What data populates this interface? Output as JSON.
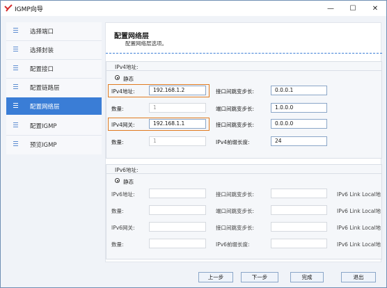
{
  "window": {
    "title": "IGMP向导",
    "minimize": "—",
    "maximize": "☐",
    "close": "✕"
  },
  "sidebar": {
    "items": [
      {
        "label": "选择端口",
        "active": false
      },
      {
        "label": "选择封装",
        "active": false
      },
      {
        "label": "配置接口",
        "active": false
      },
      {
        "label": "配置链路层",
        "active": false
      },
      {
        "label": "配置网络层",
        "active": true
      },
      {
        "label": "配置IGMP",
        "active": false
      },
      {
        "label": "预览IGMP",
        "active": false
      }
    ]
  },
  "main": {
    "title": "配置网络层",
    "subtitle": "配置网络层选项。",
    "ipv4": {
      "group_label": "IPv4地址:",
      "mode": "静态",
      "addr_label": "IPv4地址:",
      "addr_value": "192.168.1.2",
      "addr_count_label": "数量:",
      "addr_count_value": "1",
      "gw_label": "IPv4网关:",
      "gw_value": "192.168.1.1",
      "gw_count_label": "数量:",
      "gw_count_value": "1",
      "if_step_label": "接口间跳变步长:",
      "if_step_value": "0.0.0.1",
      "port_step_label": "端口间跳变步长:",
      "port_step_value": "1.0.0.0",
      "if_step2_label": "接口间跳变步长:",
      "if_step2_value": "0.0.0.0",
      "prefix_label": "IPv4前缀长度:",
      "prefix_value": "24"
    },
    "ipv6": {
      "group_label": "IPv6地址:",
      "mode": "静态",
      "addr_label": "IPv6地址:",
      "count1_label": "数量:",
      "gw_label": "IPv6网关:",
      "count2_label": "数量:",
      "if_step_label": "接口间跳变步长:",
      "port_step_label": "端口间跳变步长:",
      "if_step2_label": "接口间跳变步长:",
      "prefix_label": "IPv6前缀长度:",
      "link_local_1": "IPv6 Link Local地",
      "link_local_2": "IPv6 Link Local地",
      "link_local_3": "IPv6 Link Local地",
      "link_local_4": "IPv6 Link Local地"
    }
  },
  "footer": {
    "prev": "上一步",
    "next": "下一步",
    "finish": "完成",
    "exit": "退出"
  },
  "colors": {
    "accent": "#3a7dd6",
    "highlight": "#e07a1f"
  }
}
